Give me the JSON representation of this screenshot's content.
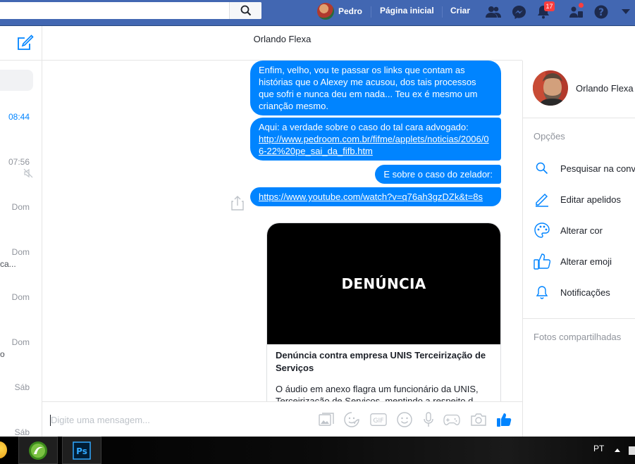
{
  "topbar": {
    "user_name": "Pedro",
    "home_label": "Página inicial",
    "create_label": "Criar",
    "notifications_count": "17"
  },
  "left": {
    "conversations": [
      {
        "time": "08:44",
        "snippet": ""
      },
      {
        "time": "07:56",
        "snippet": ""
      },
      {
        "time": "Dom",
        "snippet": ""
      },
      {
        "time": "Dom",
        "snippet": "ca..."
      },
      {
        "time": "Dom",
        "snippet": ""
      },
      {
        "time": "Dom",
        "snippet": "o"
      },
      {
        "time": "Sáb",
        "snippet": ""
      },
      {
        "time": "Sáb",
        "snippet": ""
      }
    ]
  },
  "chat": {
    "title": "Orlando Flexa",
    "messages": [
      {
        "text": "Enfim, velho, vou te passar os links que contam as histórias que o Alexey me acusou, dos tais processos que sofri e nunca deu em nada... Teu ex é mesmo um crianção mesmo."
      },
      {
        "text": "Aqui: a verdade sobre o caso do tal cara advogado:",
        "link": "http://www.pedroom.com.br/fifme/applets/noticias/2006/06-22%20pe_sai_da_fifb.htm"
      },
      {
        "text": "E sobre o caso do zelador:"
      },
      {
        "link": "https://www.youtube.com/watch?v=q76ah3gzDZk&t=8s"
      }
    ],
    "link_card": {
      "image_title": "DENÚNCIA",
      "title": "Denúncia contra empresa UNIS Terceirização de Serviços",
      "description": "O áudio em anexo flagra um funcionário da UNIS, Terceirização de Serviços, mentindo a respeito d..."
    },
    "composer_placeholder": "Digite uma mensagem..."
  },
  "right": {
    "contact_name": "Orlando Flexa",
    "options_header": "Opções",
    "options": [
      {
        "label": "Pesquisar na conversa",
        "icon": "search-icon"
      },
      {
        "label": "Editar apelidos",
        "icon": "pencil-icon"
      },
      {
        "label": "Alterar cor",
        "icon": "palette-icon"
      },
      {
        "label": "Alterar emoji",
        "icon": "thumbs-up-icon"
      },
      {
        "label": "Notificações",
        "icon": "bell-icon"
      }
    ],
    "shared_photos_header": "Fotos compartilhadas"
  },
  "taskbar": {
    "language": "PT"
  },
  "colors": {
    "brand": "#4267b2",
    "messenger_blue": "#0084ff"
  }
}
